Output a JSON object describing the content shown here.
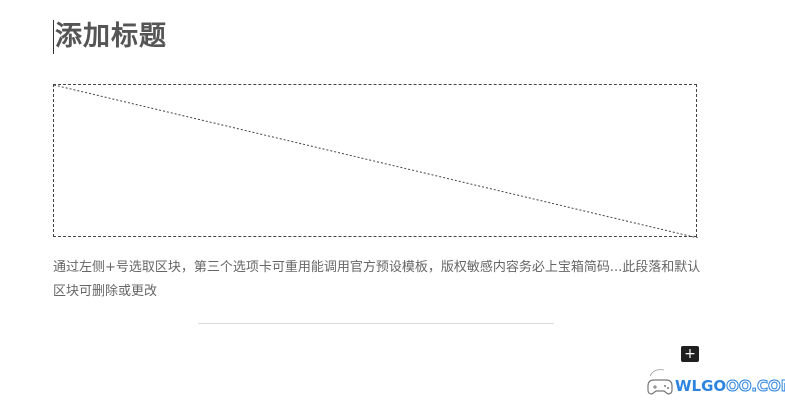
{
  "editor": {
    "title": "添加标题",
    "image_placeholder_icon": "image-placeholder",
    "paragraph": "通过左侧+号选取区块，第三个选项卡可重用能调用官方预设模板，版权敏感内容务必上宝箱简码...此段落和默认区块可删除或更改",
    "add_block_label": "+"
  },
  "watermark": {
    "prefix": "WLGO",
    "suffix": "OO.COM",
    "icon": "gamepad-logo-icon"
  }
}
